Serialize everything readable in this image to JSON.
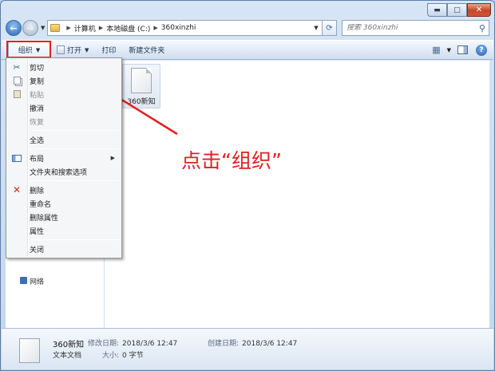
{
  "window": {
    "minimize_glyph": "▬",
    "maximize_glyph": "□",
    "close_glyph": "✕"
  },
  "address_bar": {
    "breadcrumbs": [
      "计算机",
      "本地磁盘 (C:)",
      "360xinzhi"
    ]
  },
  "search": {
    "placeholder": "搜索 360xinzhi"
  },
  "toolbar": {
    "organize_label": "组织",
    "open_label": "打开",
    "print_label": "打印",
    "new_folder_label": "新建文件夹"
  },
  "file": {
    "name": "360新知"
  },
  "nav_pane": {
    "partial_label": "网络"
  },
  "annotation": {
    "text": "点击“组织”",
    "color": "#e02020"
  },
  "menu": {
    "items": [
      {
        "label": "剪切",
        "icon": "scissors-icon",
        "disabled": false
      },
      {
        "label": "复制",
        "icon": "copy-icon",
        "disabled": false
      },
      {
        "label": "粘贴",
        "icon": "paste-icon",
        "disabled": true
      },
      {
        "label": "撤消",
        "icon": "",
        "disabled": false
      },
      {
        "label": "恢复",
        "icon": "",
        "disabled": true
      },
      {
        "label": "全选",
        "icon": "",
        "disabled": false
      },
      {
        "label": "布局",
        "icon": "layout-icon",
        "disabled": false,
        "submenu": true
      },
      {
        "label": "文件夹和搜索选项",
        "icon": "",
        "disabled": false
      },
      {
        "label": "删除",
        "icon": "delete-icon",
        "disabled": false
      },
      {
        "label": "重命名",
        "icon": "",
        "disabled": false
      },
      {
        "label": "删除属性",
        "icon": "",
        "disabled": false
      },
      {
        "label": "属性",
        "icon": "",
        "disabled": false
      },
      {
        "label": "关闭",
        "icon": "",
        "disabled": false
      }
    ]
  },
  "details": {
    "name": "360新知",
    "type": "文本文档",
    "modified_key": "修改日期:",
    "modified_value": "2018/3/6 12:47",
    "created_key": "创建日期:",
    "created_value": "2018/3/6 12:47",
    "size_key": "大小:",
    "size_value": "0 字节"
  }
}
